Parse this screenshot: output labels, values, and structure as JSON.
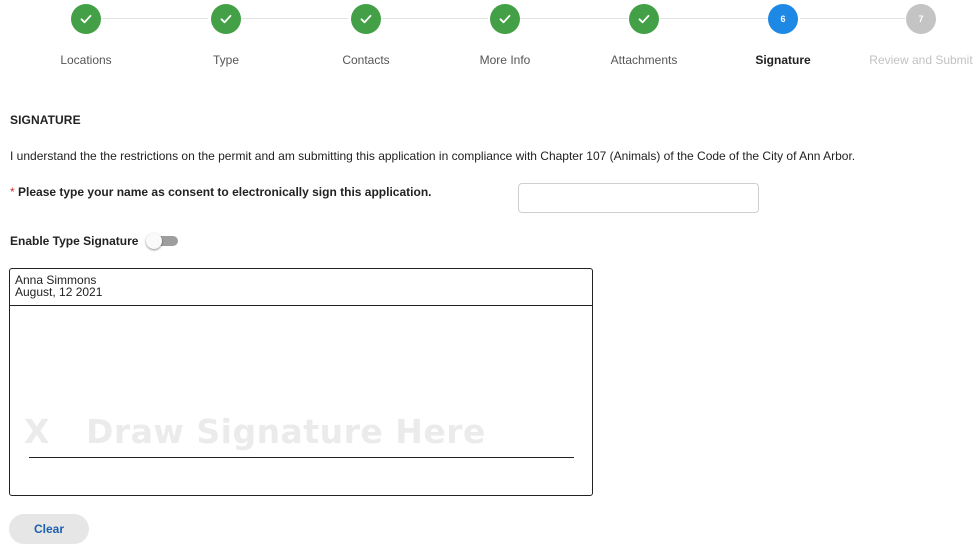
{
  "stepper": {
    "steps": [
      {
        "label": "Locations",
        "status": "done",
        "number": "1"
      },
      {
        "label": "Type",
        "status": "done",
        "number": "2"
      },
      {
        "label": "Contacts",
        "status": "done",
        "number": "3"
      },
      {
        "label": "More Info",
        "status": "done",
        "number": "4"
      },
      {
        "label": "Attachments",
        "status": "done",
        "number": "5"
      },
      {
        "label": "Signature",
        "status": "current",
        "number": "6"
      },
      {
        "label": "Review and Submit",
        "status": "pending",
        "number": "7"
      }
    ],
    "done_icon": "check-icon"
  },
  "signature_section": {
    "title": "SIGNATURE",
    "statement": "I understand the the restrictions on the permit and am submitting this application in compliance with Chapter 107 (Animals) of the Code of the City of Ann Arbor.",
    "consent_required_marker": "*",
    "consent_label": "Please type your name as consent to electronically sign this application.",
    "name_input": {
      "value": "",
      "placeholder": ""
    },
    "type_signature_toggle": {
      "label": "Enable Type Signature",
      "enabled": false
    }
  },
  "signature_pad": {
    "signer_name": "Anna Simmons",
    "signed_date": "August, 12 2021",
    "placeholder_mark": "X",
    "placeholder_text": "Draw Signature Here"
  },
  "actions": {
    "clear_label": "Clear"
  },
  "colors": {
    "step_done": "#43a047",
    "step_current": "#1e88e5",
    "step_pending": "#c4c4c4",
    "required_marker": "#d32f2f",
    "button_text": "#1e5faf"
  }
}
